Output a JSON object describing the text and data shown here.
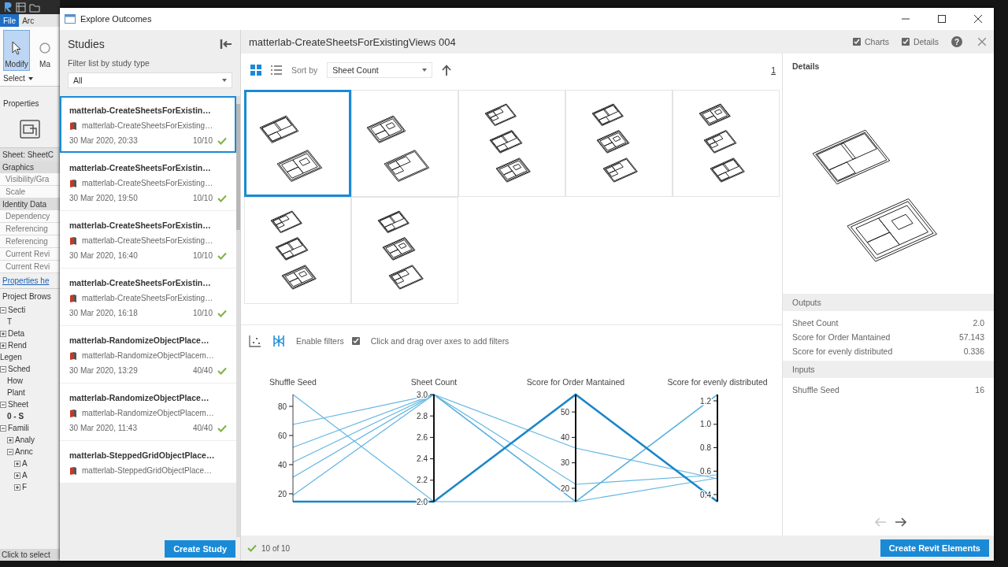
{
  "revit": {
    "ribbon_tabs": [
      {
        "label": "File",
        "selected": true
      },
      {
        "label": "Arc",
        "selected": false
      }
    ],
    "tools": [
      {
        "label": "Modify",
        "selected": true
      },
      {
        "label": "Ma",
        "selected": false
      }
    ],
    "select_menu": "Select",
    "properties": {
      "title": "Properties",
      "type": "Sheet: SheetC",
      "rows": [
        {
          "kind": "group",
          "text": "Graphics"
        },
        {
          "kind": "row",
          "text": "Visibility/Gra"
        },
        {
          "kind": "row",
          "text": "Scale"
        },
        {
          "kind": "group",
          "text": "Identity Data"
        },
        {
          "kind": "row",
          "text": "Dependency"
        },
        {
          "kind": "row",
          "text": "Referencing"
        },
        {
          "kind": "row",
          "text": "Referencing"
        },
        {
          "kind": "row",
          "text": "Current Revi"
        },
        {
          "kind": "row",
          "text": "Current Revi"
        }
      ],
      "help_link": "Properties he"
    },
    "browser": {
      "title": "Project Brows",
      "tree": [
        {
          "label": "Secti",
          "expanded": true,
          "children": [
            {
              "label": "T"
            }
          ]
        },
        {
          "label": "Deta",
          "expanded": false
        },
        {
          "label": "Rend",
          "expanded": false
        },
        {
          "label": "Legen"
        },
        {
          "label": "Sched",
          "expanded": true,
          "children": [
            {
              "label": "How"
            },
            {
              "label": "Plant"
            }
          ]
        },
        {
          "label": "Sheet",
          "expanded": true,
          "children": [
            {
              "label": "0 - S",
              "selected": true
            }
          ]
        },
        {
          "label": "Famili",
          "expanded": true,
          "children": [
            {
              "label": "Analy",
              "expanded": false
            },
            {
              "label": "Annc",
              "expanded": true,
              "children": [
                {
                  "label": "A",
                  "expanded": false
                },
                {
                  "label": "A",
                  "expanded": false
                },
                {
                  "label": "F",
                  "expanded": false
                }
              ]
            }
          ]
        }
      ]
    },
    "status": "Click to select"
  },
  "window": {
    "title": "Explore Outcomes"
  },
  "studies": {
    "title": "Studies",
    "filter_label": "Filter list by study type",
    "filter_value": "All",
    "items": [
      {
        "title": "matterlab-CreateSheetsForExistin…",
        "subtitle": "matterlab-CreateSheetsForExisting…",
        "date": "30 Mar 2020, 20:33",
        "count": "10/10",
        "selected": true
      },
      {
        "title": "matterlab-CreateSheetsForExistin…",
        "subtitle": "matterlab-CreateSheetsForExisting…",
        "date": "30 Mar 2020, 19:50",
        "count": "10/10",
        "selected": false
      },
      {
        "title": "matterlab-CreateSheetsForExistin…",
        "subtitle": "matterlab-CreateSheetsForExisting…",
        "date": "30 Mar 2020, 16:40",
        "count": "10/10",
        "selected": false
      },
      {
        "title": "matterlab-CreateSheetsForExistin…",
        "subtitle": "matterlab-CreateSheetsForExisting…",
        "date": "30 Mar 2020, 16:18",
        "count": "10/10",
        "selected": false
      },
      {
        "title": "matterlab-RandomizeObjectPlace…",
        "subtitle": "matterlab-RandomizeObjectPlacem…",
        "date": "30 Mar 2020, 13:29",
        "count": "40/40",
        "selected": false
      },
      {
        "title": "matterlab-RandomizeObjectPlace…",
        "subtitle": "matterlab-RandomizeObjectPlacem…",
        "date": "30 Mar 2020, 11:43",
        "count": "40/40",
        "selected": false
      },
      {
        "title": "matterlab-SteppedGridObjectPlace…",
        "subtitle": "matterlab-SteppedGridObjectPlace…",
        "selected": false
      }
    ],
    "create_button": "Create Study"
  },
  "header": {
    "title": "matterlab-CreateSheetsForExistingViews 004",
    "toggles": [
      {
        "label": "Charts",
        "checked": true
      },
      {
        "label": "Details",
        "checked": true
      }
    ],
    "help": "?"
  },
  "toolbar": {
    "views": [
      {
        "kind": "grid",
        "selected": true
      },
      {
        "kind": "list",
        "selected": false
      }
    ],
    "sort_label": "Sort by",
    "sort_value": "Sheet Count",
    "page": "1"
  },
  "outcomes": [
    {
      "kind": "two",
      "selected": true
    },
    {
      "kind": "two",
      "selected": false
    },
    {
      "kind": "three",
      "selected": false
    },
    {
      "kind": "three",
      "selected": false
    },
    {
      "kind": "three",
      "selected": false
    },
    {
      "kind": "three",
      "selected": false
    },
    {
      "kind": "three",
      "selected": false
    }
  ],
  "chart_panel": {
    "modes": [
      {
        "kind": "scatter",
        "selected": false
      },
      {
        "kind": "parallel",
        "selected": true
      }
    ],
    "filters_label": "Enable filters",
    "filters_enabled": true,
    "hint": "Click and drag over axes to add filters",
    "parallel_plot": {
      "axes": [
        {
          "title": "Shuffle Seed",
          "ticks": [
            "80",
            "60",
            "40",
            "20"
          ]
        },
        {
          "title": "Sheet Count",
          "ticks": [
            "3.0",
            "2.8",
            "2.6",
            "2.4",
            "2.2",
            "2.0"
          ]
        },
        {
          "title": "Score for Order Mantained",
          "ticks": [
            "50",
            "40",
            "30",
            "20"
          ]
        },
        {
          "title": "Score for evenly distributed",
          "ticks": [
            "1.2",
            "1.0",
            "0.8",
            "0.6",
            "0.4"
          ]
        }
      ]
    }
  },
  "details": {
    "title": "Details",
    "outputs_title": "Outputs",
    "outputs": [
      {
        "label": "Sheet Count",
        "value": "2.0"
      },
      {
        "label": "Score for Order Mantained",
        "value": "57.143"
      },
      {
        "label": "Score for evenly distributed",
        "value": "0.336"
      }
    ],
    "inputs_title": "Inputs",
    "inputs": [
      {
        "label": "Shuffle Seed",
        "value": "16"
      }
    ],
    "previous_disabled": true,
    "next_disabled": false
  },
  "footer": {
    "count": "10 of 10",
    "create_button": "Create Revit Elements"
  }
}
